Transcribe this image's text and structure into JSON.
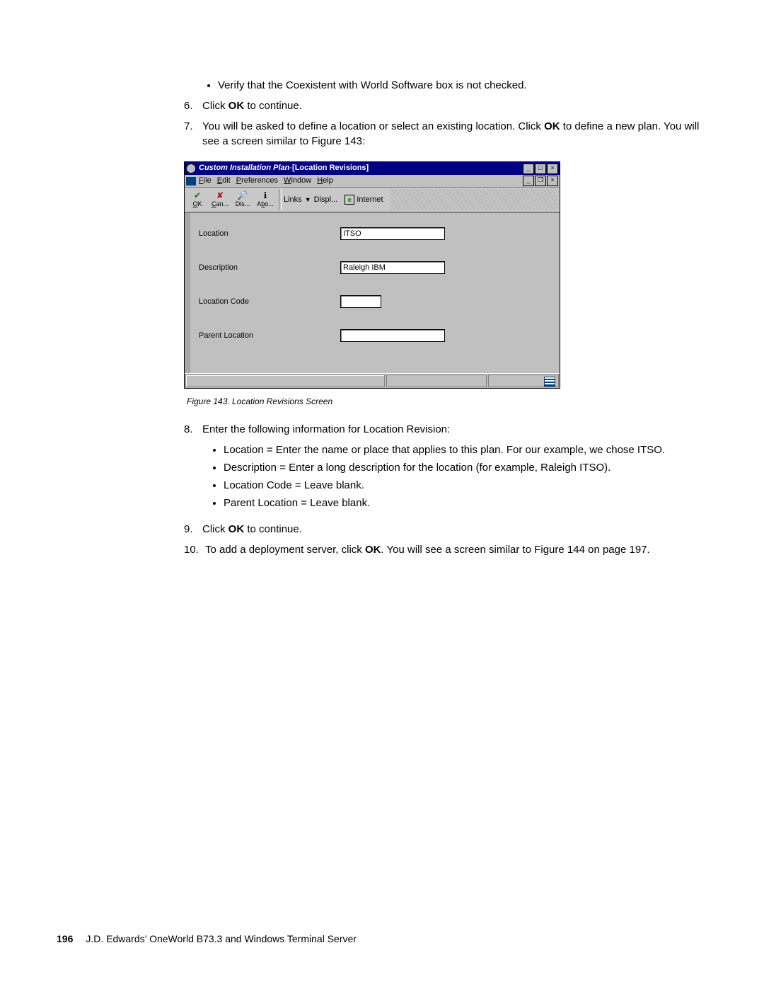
{
  "intro_bullet": "Verify that the Coexistent with World Software box is not checked.",
  "step6": {
    "num": "6.",
    "pre": "Click ",
    "bold": "OK",
    "post": " to continue."
  },
  "step7": {
    "num": "7.",
    "pre": "You will be asked to define a location or select an existing location. Click ",
    "bold": "OK",
    "post": " to define a new plan. You will see a screen similar to Figure 143:"
  },
  "win": {
    "title_a": "Custom Installation Plan",
    "title_sep": "  - ",
    "title_b": "[Location Revisions]",
    "menus": {
      "file": "File",
      "edit": "Edit",
      "prefs": "Preferences",
      "window": "Window",
      "help": "Help"
    },
    "tb": {
      "ok": "OK",
      "can": "Can...",
      "dis": "Dis...",
      "abo": "Abo...",
      "links": "Links",
      "displ": "Displ...",
      "internet": "Internet"
    },
    "form": {
      "l_location": "Location",
      "v_location": "ITSO",
      "l_description": "Description",
      "v_description": "Raleigh IBM",
      "l_code": "Location Code",
      "v_code": "",
      "l_parent": "Parent Location",
      "v_parent": ""
    }
  },
  "fig_caption": "Figure 143. Location Revisions Screen",
  "step8": {
    "num": "8.",
    "text": "Enter the following information for Location Revision:"
  },
  "s8_b1": "Location = Enter the name or place that applies to this plan. For our example, we chose ITSO.",
  "s8_b2": "Description = Enter a long description for the location (for example, Raleigh ITSO).",
  "s8_b3": "Location Code = Leave blank.",
  "s8_b4": "Parent Location = Leave blank.",
  "step9": {
    "num": "9.",
    "pre": "Click ",
    "bold": "OK",
    "post": " to continue."
  },
  "step10": {
    "num": "10.",
    "pre": "To add a deployment server, click ",
    "bold": "OK",
    "post": ". You will see a screen similar to Figure 144 on page 197."
  },
  "footer": {
    "page": "196",
    "text": "J.D. Edwards’ OneWorld B73.3 and Windows Terminal Server"
  }
}
